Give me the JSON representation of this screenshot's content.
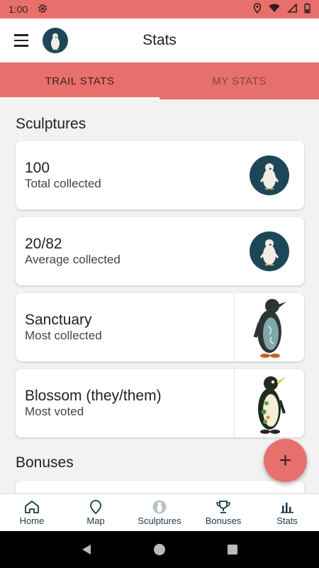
{
  "status_bar": {
    "time": "1:00"
  },
  "app_bar": {
    "title": "Stats"
  },
  "tabs": [
    {
      "label": "TRAIL STATS",
      "active": true
    },
    {
      "label": "MY STATS",
      "active": false
    }
  ],
  "sections": {
    "sculptures_title": "Sculptures",
    "bonuses_title": "Bonuses"
  },
  "cards": [
    {
      "value": "100",
      "caption": "Total collected"
    },
    {
      "value": "20/82",
      "caption": "Average collected"
    },
    {
      "value": "Sanctuary",
      "caption": "Most collected"
    },
    {
      "value": "Blossom (they/them)",
      "caption": "Most voted"
    }
  ],
  "fab": {
    "label": "+"
  },
  "bottom_nav": [
    {
      "label": "Home",
      "icon": "home-icon"
    },
    {
      "label": "Map",
      "icon": "map-pin-icon"
    },
    {
      "label": "Sculptures",
      "icon": "penguin-icon"
    },
    {
      "label": "Bonuses",
      "icon": "trophy-icon"
    },
    {
      "label": "Stats",
      "icon": "bar-chart-icon"
    }
  ],
  "colors": {
    "accent": "#e8706c",
    "navy": "#1d4756",
    "background": "#f2f2f2"
  }
}
